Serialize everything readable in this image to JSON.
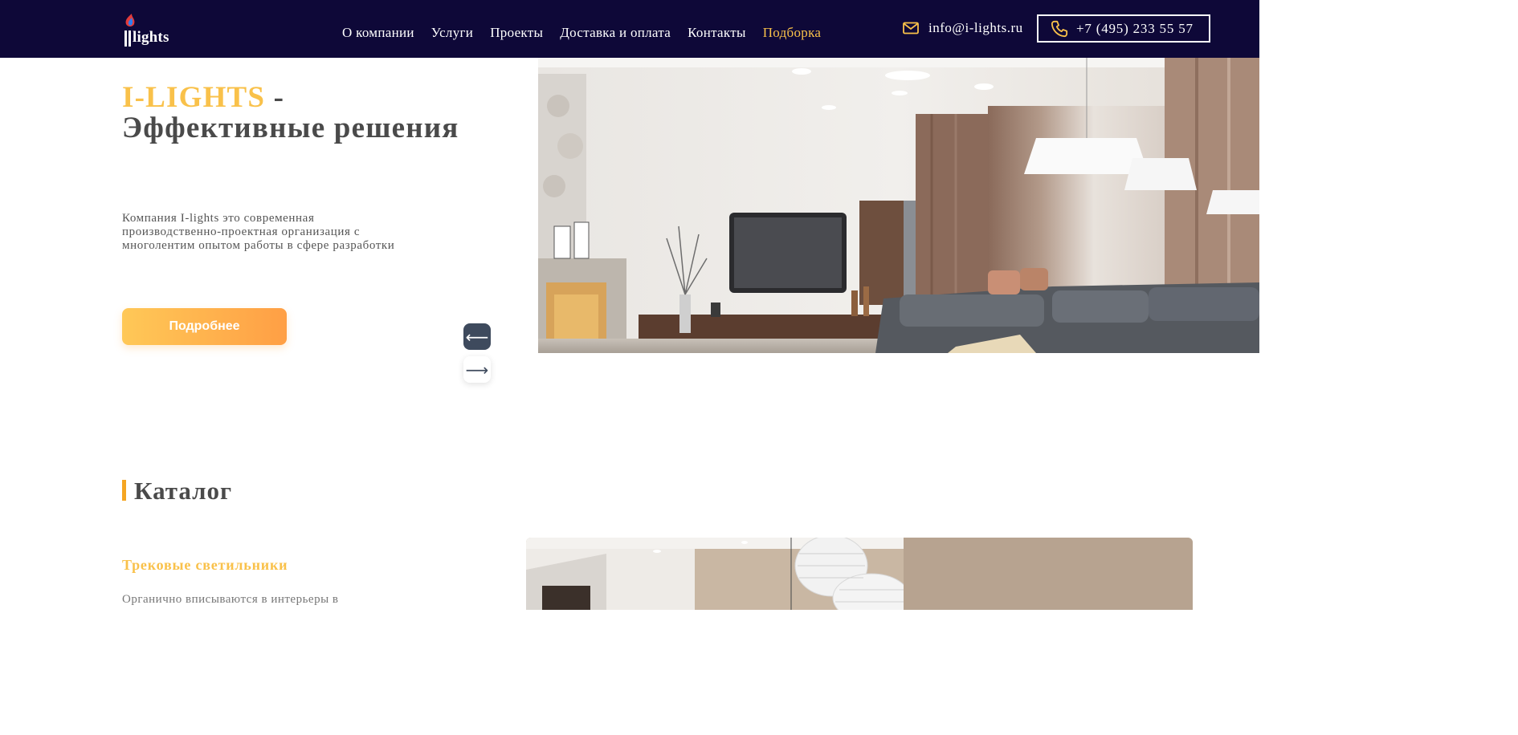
{
  "header": {
    "logo_text": "lights",
    "nav": [
      {
        "label": "О компании",
        "active": false
      },
      {
        "label": "Услуги",
        "active": false
      },
      {
        "label": "Проекты",
        "active": false
      },
      {
        "label": "Доставка и оплата",
        "active": false
      },
      {
        "label": "Контакты",
        "active": false
      },
      {
        "label": "Подборка",
        "active": true
      }
    ],
    "email": "info@i-lights.ru",
    "phone": "+7 (495) 233 55 57"
  },
  "hero": {
    "brand": "I-LIGHTS",
    "dash": " -",
    "title_rest": "Эффективные решения",
    "description": "Компания I-lights это современная производственно-проектная организация с многолентим опытом работы в сфере разработки",
    "button_label": "Подробнее",
    "prev_arrow": "⟵",
    "next_arrow": "⟶"
  },
  "catalog": {
    "title": "Каталог",
    "item_title": "Трековые светильники",
    "item_desc": "Органично вписываются в интерьеры в"
  },
  "colors": {
    "header_bg": "#0e0838",
    "accent": "#f9c14a",
    "button_gradient_start": "#ffc857",
    "button_gradient_end": "#ff9f45",
    "arrow_active": "#3e4a5d"
  },
  "icons": {
    "logo": "i-lights-logo",
    "mail": "mail-icon",
    "phone": "phone-icon"
  }
}
